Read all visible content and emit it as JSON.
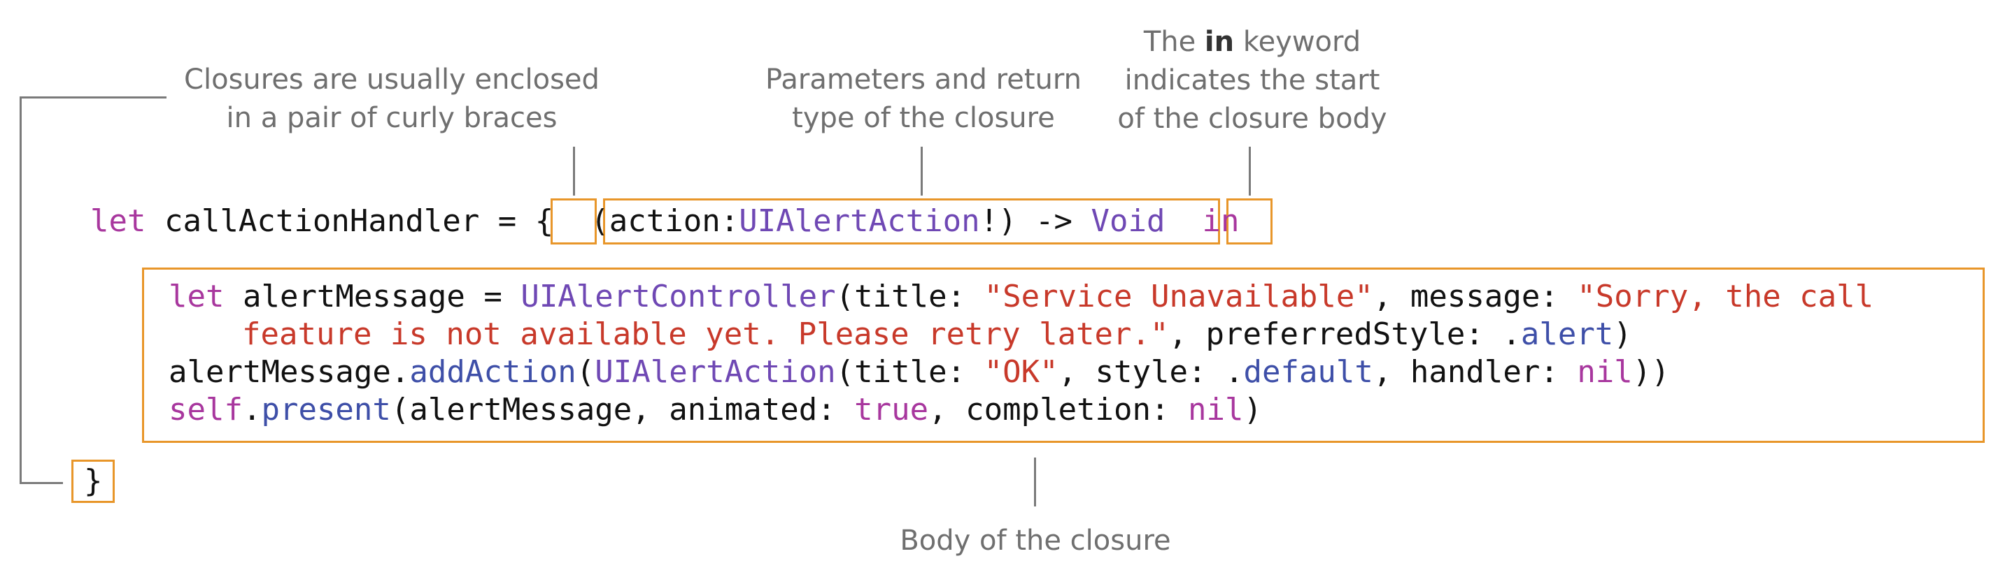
{
  "annotations": {
    "braces": [
      "Closures are usually enclosed",
      "in a pair of curly braces"
    ],
    "params": [
      "Parameters and return",
      "type of the closure"
    ],
    "in_kw": {
      "line1_pre": "The ",
      "line1_bold": "in",
      "line1_post": " keyword",
      "line2": "indicates the start",
      "line3": "of the closure body"
    },
    "body": "Body of the closure"
  },
  "code": {
    "l1_let": "let",
    "l1_name": " callActionHandler = ",
    "l1_open": "{",
    "l1_p1": "(action:",
    "l1_type": "UIAlertAction",
    "l1_p2": "!) -> ",
    "l1_void": "Void",
    "l1_in": "in",
    "b1_let": "let",
    "b1_a": " alertMessage = ",
    "b1_cls": "UIAlertController",
    "b1_b": "(title: ",
    "b1_s1": "\"Service Unavailable\"",
    "b1_c": ", message: ",
    "b1_s2": "\"Sorry, the call",
    "b2_s": "feature is not available yet. Please retry later.\"",
    "b2_a": ", preferredStyle: .",
    "b2_alert": "alert",
    "b2_b": ")",
    "b3_a": "alertMessage.",
    "b3_fn": "addAction",
    "b3_b": "(",
    "b3_cls": "UIAlertAction",
    "b3_c": "(title: ",
    "b3_s": "\"OK\"",
    "b3_d": ", style: .",
    "b3_def": "default",
    "b3_e": ", handler: ",
    "b3_nil": "nil",
    "b3_f": "))",
    "b4_self": "self",
    "b4_a": ".",
    "b4_fn": "present",
    "b4_b": "(alertMessage, animated: ",
    "b4_true": "true",
    "b4_c": ", completion: ",
    "b4_nil": "nil",
    "b4_d": ")",
    "close": "}"
  },
  "colors": {
    "highlight_box": "#e8962a",
    "keyword": "#a8379e",
    "type": "#6f48b4",
    "string": "#c8392a",
    "method": "#3e4fa8",
    "annotation_text": "#6f6f6f"
  }
}
